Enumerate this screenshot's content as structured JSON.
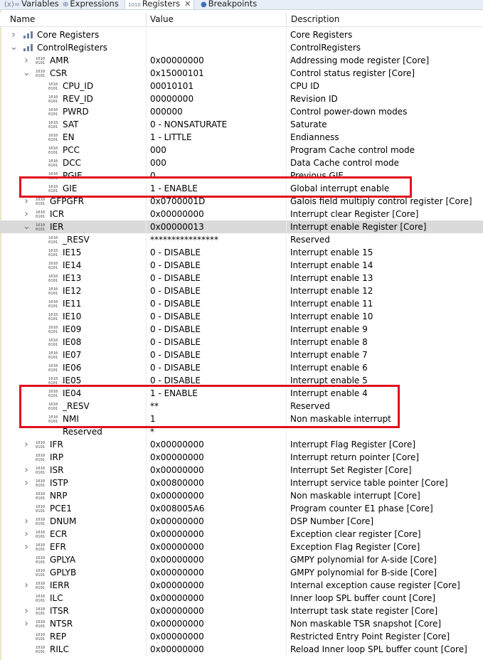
{
  "tabs": [
    {
      "label": "Variables",
      "icon": "(x)=",
      "active": false
    },
    {
      "label": "Expressions",
      "icon": "⊕",
      "active": false
    },
    {
      "label": "Registers",
      "icon": "1010",
      "active": true
    },
    {
      "label": "Breakpoints",
      "icon": "●",
      "active": false
    }
  ],
  "columns": {
    "name": "Name",
    "value": "Value",
    "description": "Description"
  },
  "rows": [
    {
      "depth": 0,
      "tw": ">",
      "icon": "group",
      "name": "Core Registers",
      "value": "",
      "desc": "Core Registers"
    },
    {
      "depth": 0,
      "tw": "v",
      "icon": "group",
      "name": "ControlRegisters",
      "value": "",
      "desc": "ControlRegisters"
    },
    {
      "depth": 1,
      "tw": ">",
      "icon": "reg",
      "name": "AMR",
      "value": "0x00000000",
      "desc": "Addressing mode register [Core]"
    },
    {
      "depth": 1,
      "tw": "v",
      "icon": "reg",
      "name": "CSR",
      "value": "0x15000101",
      "desc": "Control status register [Core]"
    },
    {
      "depth": 2,
      "tw": "",
      "icon": "reg",
      "name": "CPU_ID",
      "value": "00010101",
      "desc": "CPU ID"
    },
    {
      "depth": 2,
      "tw": "",
      "icon": "reg",
      "name": "REV_ID",
      "value": "00000000",
      "desc": "Revision ID"
    },
    {
      "depth": 2,
      "tw": "",
      "icon": "reg",
      "name": "PWRD",
      "value": "000000",
      "desc": "Control power-down modes"
    },
    {
      "depth": 2,
      "tw": "",
      "icon": "reg",
      "name": "SAT",
      "value": "0 - NONSATURATE",
      "desc": "Saturate"
    },
    {
      "depth": 2,
      "tw": "",
      "icon": "reg",
      "name": "EN",
      "value": "1 - LITTLE",
      "desc": "Endianness"
    },
    {
      "depth": 2,
      "tw": "",
      "icon": "reg",
      "name": "PCC",
      "value": "000",
      "desc": "Program Cache control mode"
    },
    {
      "depth": 2,
      "tw": "",
      "icon": "reg",
      "name": "DCC",
      "value": "000",
      "desc": "Data Cache control mode"
    },
    {
      "depth": 2,
      "tw": "",
      "icon": "reg",
      "name": "PGIE",
      "value": "0",
      "desc": "Previous GIE"
    },
    {
      "depth": 2,
      "tw": "",
      "icon": "reg",
      "name": "GIE",
      "value": "1 - ENABLE",
      "desc": "Global interrupt enable"
    },
    {
      "depth": 1,
      "tw": ">",
      "icon": "reg",
      "name": "GFPGFR",
      "value": "0x0700001D",
      "desc": "Galois field multiply control register [Core]"
    },
    {
      "depth": 1,
      "tw": ">",
      "icon": "reg",
      "name": "ICR",
      "value": "0x00000000",
      "desc": "Interrupt clear Register [Core]"
    },
    {
      "depth": 1,
      "tw": "v",
      "icon": "reg",
      "name": "IER",
      "value": "0x00000013",
      "desc": "Interrupt enable Register [Core]",
      "selected": true
    },
    {
      "depth": 2,
      "tw": "",
      "icon": "reg",
      "name": "_RESV",
      "value": "****************",
      "desc": "Reserved"
    },
    {
      "depth": 2,
      "tw": "",
      "icon": "reg",
      "name": "IE15",
      "value": "0 - DISABLE",
      "desc": "Interrupt enable 15"
    },
    {
      "depth": 2,
      "tw": "",
      "icon": "reg",
      "name": "IE14",
      "value": "0 - DISABLE",
      "desc": "Interrupt enable 14"
    },
    {
      "depth": 2,
      "tw": "",
      "icon": "reg",
      "name": "IE13",
      "value": "0 - DISABLE",
      "desc": "Interrupt enable 13"
    },
    {
      "depth": 2,
      "tw": "",
      "icon": "reg",
      "name": "IE12",
      "value": "0 - DISABLE",
      "desc": "Interrupt enable 12"
    },
    {
      "depth": 2,
      "tw": "",
      "icon": "reg",
      "name": "IE11",
      "value": "0 - DISABLE",
      "desc": "Interrupt enable 11"
    },
    {
      "depth": 2,
      "tw": "",
      "icon": "reg",
      "name": "IE10",
      "value": "0 - DISABLE",
      "desc": "Interrupt enable 10"
    },
    {
      "depth": 2,
      "tw": "",
      "icon": "reg",
      "name": "IE09",
      "value": "0 - DISABLE",
      "desc": "Interrupt enable 9"
    },
    {
      "depth": 2,
      "tw": "",
      "icon": "reg",
      "name": "IE08",
      "value": "0 - DISABLE",
      "desc": "Interrupt enable 8"
    },
    {
      "depth": 2,
      "tw": "",
      "icon": "reg",
      "name": "IE07",
      "value": "0 - DISABLE",
      "desc": "Interrupt enable 7"
    },
    {
      "depth": 2,
      "tw": "",
      "icon": "reg",
      "name": "IE06",
      "value": "0 - DISABLE",
      "desc": "Interrupt enable 6"
    },
    {
      "depth": 2,
      "tw": "",
      "icon": "reg",
      "name": "IE05",
      "value": "0 - DISABLE",
      "desc": "Interrupt enable 5"
    },
    {
      "depth": 2,
      "tw": "",
      "icon": "reg",
      "name": "IE04",
      "value": "1 - ENABLE",
      "desc": "Interrupt enable 4"
    },
    {
      "depth": 2,
      "tw": "",
      "icon": "reg",
      "name": "_RESV",
      "value": "**",
      "desc": "Reserved"
    },
    {
      "depth": 2,
      "tw": "",
      "icon": "reg",
      "name": "NMI",
      "value": "1",
      "desc": "Non maskable interrupt"
    },
    {
      "depth": 2,
      "tw": "",
      "icon": "none",
      "name": "Reserved",
      "value": "*",
      "desc": ""
    },
    {
      "depth": 1,
      "tw": ">",
      "icon": "reg",
      "name": "IFR",
      "value": "0x00000000",
      "desc": "Interrupt Flag Register [Core]"
    },
    {
      "depth": 1,
      "tw": "",
      "icon": "reg",
      "name": "IRP",
      "value": "0x00000000",
      "desc": "Interrupt return pointer [Core]"
    },
    {
      "depth": 1,
      "tw": ">",
      "icon": "reg",
      "name": "ISR",
      "value": "0x00000000",
      "desc": "Interrupt Set Register [Core]"
    },
    {
      "depth": 1,
      "tw": ">",
      "icon": "reg",
      "name": "ISTP",
      "value": "0x00800000",
      "desc": "Interrupt service table pointer [Core]"
    },
    {
      "depth": 1,
      "tw": "",
      "icon": "reg",
      "name": "NRP",
      "value": "0x00000000",
      "desc": "Non maskable interrupt [Core]"
    },
    {
      "depth": 1,
      "tw": "",
      "icon": "reg",
      "name": "PCE1",
      "value": "0x008005A6",
      "desc": "Program counter E1 phase [Core]"
    },
    {
      "depth": 1,
      "tw": ">",
      "icon": "reg",
      "name": "DNUM",
      "value": "0x00000000",
      "desc": "DSP Number [Core]"
    },
    {
      "depth": 1,
      "tw": ">",
      "icon": "reg",
      "name": "ECR",
      "value": "0x00000000",
      "desc": "Exception clear register [Core]"
    },
    {
      "depth": 1,
      "tw": ">",
      "icon": "reg",
      "name": "EFR",
      "value": "0x00000000",
      "desc": "Exception Flag Register [Core]"
    },
    {
      "depth": 1,
      "tw": "",
      "icon": "reg",
      "name": "GPLYA",
      "value": "0x00000000",
      "desc": "GMPY polynomial for A-side [Core]"
    },
    {
      "depth": 1,
      "tw": "",
      "icon": "reg",
      "name": "GPLYB",
      "value": "0x00000000",
      "desc": "GMPY polynomial for B-side [Core]"
    },
    {
      "depth": 1,
      "tw": ">",
      "icon": "reg",
      "name": "IERR",
      "value": "0x00000000",
      "desc": "Internal exception cause register [Core]"
    },
    {
      "depth": 1,
      "tw": "",
      "icon": "reg",
      "name": "ILC",
      "value": "0x00000000",
      "desc": "Inner loop SPL buffer count [Core]"
    },
    {
      "depth": 1,
      "tw": ">",
      "icon": "reg",
      "name": "ITSR",
      "value": "0x00000000",
      "desc": "Interrupt task state register [Core]"
    },
    {
      "depth": 1,
      "tw": ">",
      "icon": "reg",
      "name": "NTSR",
      "value": "0x00000000",
      "desc": "Non maskable TSR snapshot [Core]"
    },
    {
      "depth": 1,
      "tw": "",
      "icon": "reg",
      "name": "REP",
      "value": "0x00000000",
      "desc": "Restricted Entry Point Register [Core]"
    },
    {
      "depth": 1,
      "tw": "",
      "icon": "reg",
      "name": "RILC",
      "value": "0x00000000",
      "desc": "Reload Inner loop SPL buffer count [Core]"
    }
  ],
  "colors": {
    "highlight": "#e0101c",
    "selected_row": "#dadada",
    "tab_bar": "#e8eef7"
  }
}
